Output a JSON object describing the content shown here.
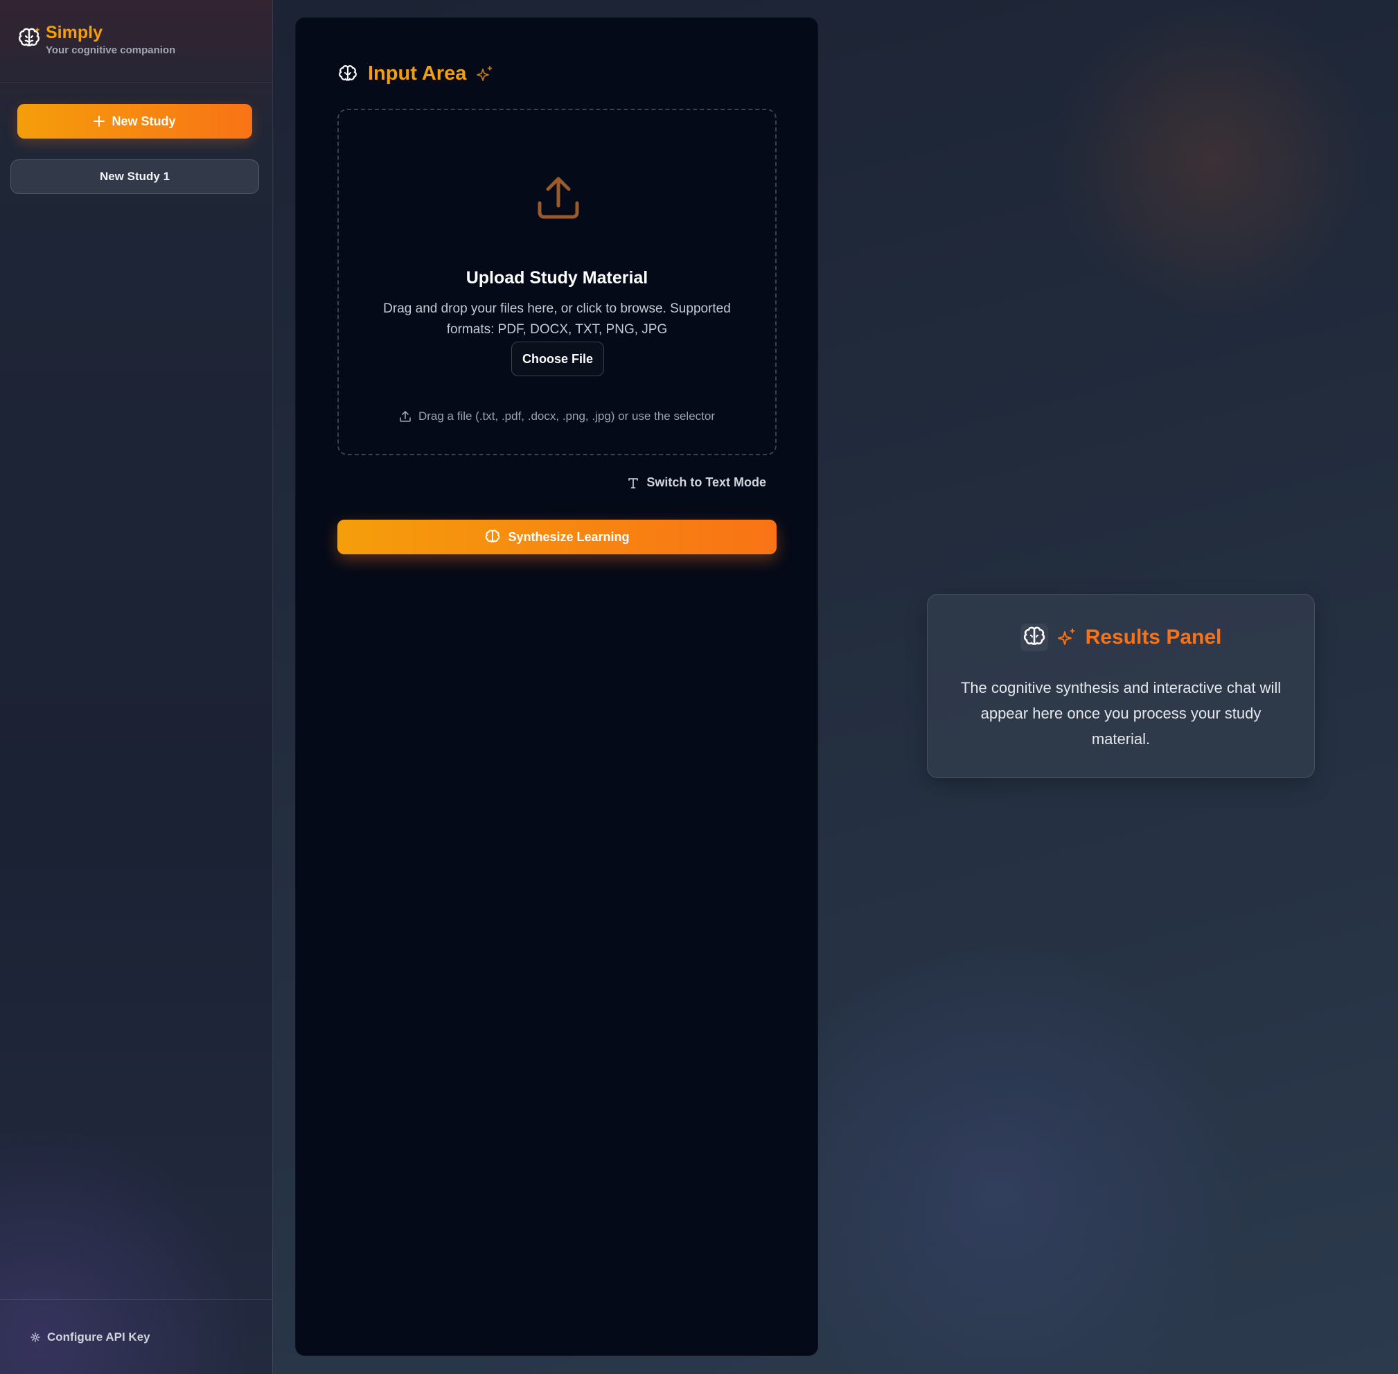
{
  "brand": {
    "title": "Simply",
    "subtitle": "Your cognitive companion"
  },
  "sidebar": {
    "new_study_label": "New Study",
    "items": [
      {
        "label": "New Study 1"
      }
    ],
    "footer": {
      "label": "Configure API Key"
    }
  },
  "input": {
    "title": "Input Area",
    "upload_title": "Upload Study Material",
    "upload_desc": "Drag and drop your files here, or click to browse. Supported formats: PDF, DOCX, TXT, PNG, JPG",
    "choose_label": "Choose File",
    "hint": "Drag a file (.txt, .pdf, .docx, .png, .jpg) or use the selector",
    "switch_label": "Switch to Text Mode",
    "synth_label": "Synthesize Learning"
  },
  "results": {
    "title": "Results Panel",
    "body": "The cognitive synthesis and interactive chat will appear here once you process your study material."
  },
  "colors": {
    "accent": "#f59e0b",
    "accent2": "#f97316",
    "panel": "#050a18"
  }
}
